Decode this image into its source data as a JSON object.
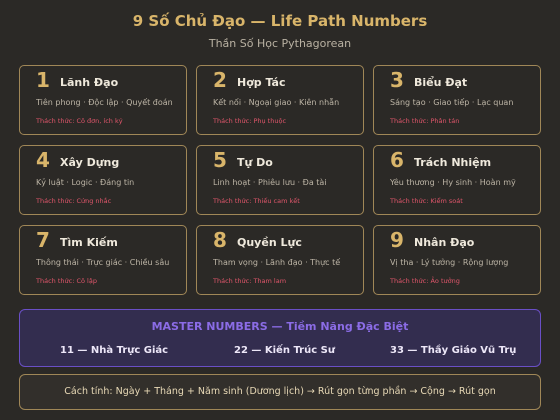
{
  "header": {
    "title": "9 Số Chủ Đạo — Life Path Numbers",
    "subtitle": "Thần Số Học Pythagorean"
  },
  "cards": [
    {
      "number": "1",
      "name": "Lãnh Đạo",
      "traits": "Tiên phong · Độc lập · Quyết đoán",
      "challenge": "Thách thức: Cô đơn, ích kỷ"
    },
    {
      "number": "2",
      "name": "Hợp Tác",
      "traits": "Kết nối · Ngoại giao · Kiên nhẫn",
      "challenge": "Thách thức: Phụ thuộc"
    },
    {
      "number": "3",
      "name": "Biểu Đạt",
      "traits": "Sáng tạo · Giao tiếp · Lạc quan",
      "challenge": "Thách thức: Phân tán"
    },
    {
      "number": "4",
      "name": "Xây Dựng",
      "traits": "Kỷ luật · Logic · Đáng tin",
      "challenge": "Thách thức: Cứng nhắc"
    },
    {
      "number": "5",
      "name": "Tự Do",
      "traits": "Linh hoạt · Phiêu lưu · Đa tài",
      "challenge": "Thách thức: Thiếu cam kết"
    },
    {
      "number": "6",
      "name": "Trách Nhiệm",
      "traits": "Yêu thương · Hy sinh · Hoàn mỹ",
      "challenge": "Thách thức: Kiểm soát"
    },
    {
      "number": "7",
      "name": "Tìm Kiếm",
      "traits": "Thông thái · Trực giác · Chiều sâu",
      "challenge": "Thách thức: Cô lập"
    },
    {
      "number": "8",
      "name": "Quyền Lực",
      "traits": "Tham vọng · Lãnh đạo · Thực tế",
      "challenge": "Thách thức: Tham lam"
    },
    {
      "number": "9",
      "name": "Nhân Đạo",
      "traits": "Vị tha · Lý tưởng · Rộng lượng",
      "challenge": "Thách thức: Ảo tưởng"
    }
  ],
  "master": {
    "title": "MASTER NUMBERS — Tiềm Năng Đặc Biệt",
    "items": [
      "11 — Nhà Trực Giác",
      "22 — Kiến Trúc Sư",
      "33 — Thầy Giáo Vũ Trụ"
    ]
  },
  "formula": "Cách tính: Ngày + Tháng + Năm sinh (Dương lịch) → Rút gọn từng phần → Cộng → Rút gọn",
  "colors": {
    "background": "#2b2926",
    "gold": "#d9b56a",
    "challenge_red": "#e0566b",
    "master_purple": "#8b6ce6"
  }
}
